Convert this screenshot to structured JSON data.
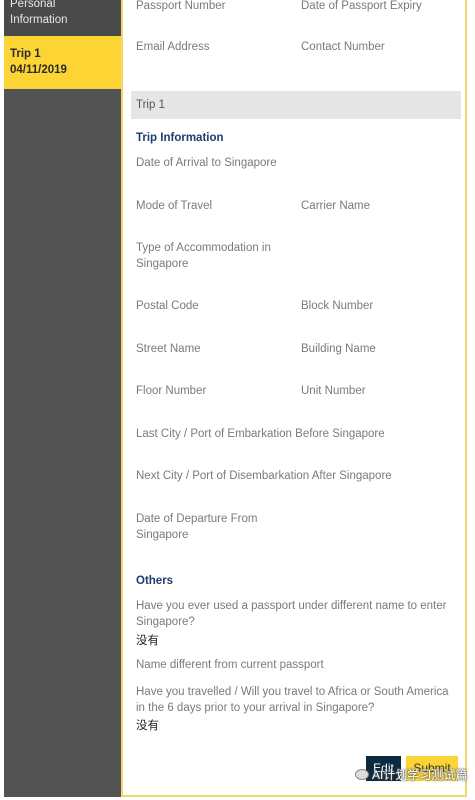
{
  "sidebar": {
    "personal_line1": "Personal",
    "personal_line2": "Information",
    "trip_label": "Trip 1",
    "trip_date": "04/11/2019"
  },
  "personal": {
    "passport_number": "Passport Number",
    "passport_expiry": "Date of Passport Expiry",
    "email": "Email Address",
    "contact": "Contact Number"
  },
  "trip_bar": "Trip 1",
  "trip_info": {
    "title": "Trip Information",
    "arrival": "Date of Arrival to Singapore",
    "mode": "Mode of Travel",
    "carrier": "Carrier Name",
    "accommodation_line1": "Type of Accommodation in",
    "accommodation_line2": "Singapore",
    "postal": "Postal Code",
    "block": "Block Number",
    "street": "Street Name",
    "building": "Building Name",
    "floor": "Floor Number",
    "unit": "Unit Number",
    "last_city": "Last City / Port of Embarkation Before Singapore",
    "next_city": "Next City / Port of Disembarkation After Singapore",
    "departure_line1": "Date of Departure From",
    "departure_line2": "Singapore"
  },
  "others": {
    "title": "Others",
    "q1_line1": "Have you ever used a passport under different name to enter",
    "q1_line2": "Singapore?",
    "a1": "没有",
    "name_diff": "Name different from current passport",
    "q2_line1": "Have you travelled / Will you travel to Africa or South America",
    "q2_line2": "in the 6 days prior to your arrival in Singapore?",
    "a2": "没有"
  },
  "buttons": {
    "edit": "Edit",
    "submit": "Submit"
  },
  "watermark": "AI计划学习测试篇"
}
